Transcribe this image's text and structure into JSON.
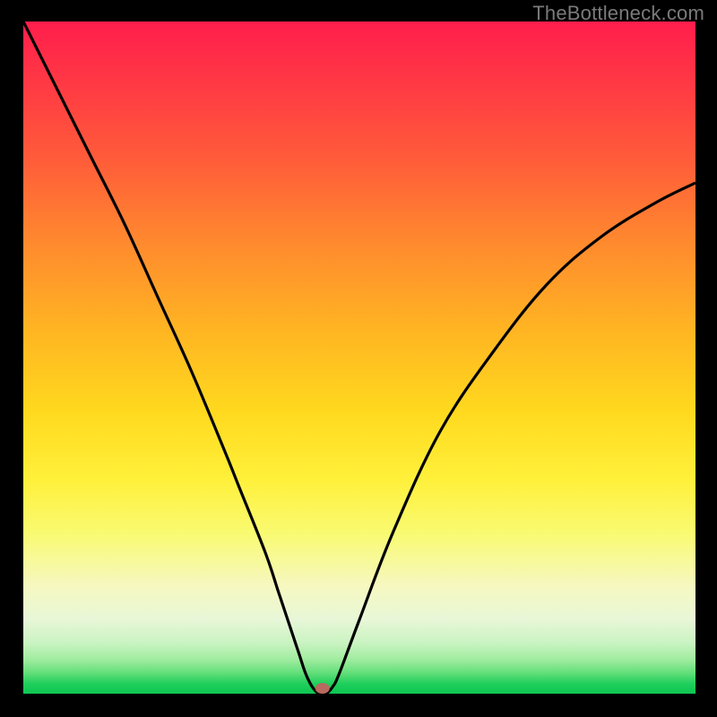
{
  "watermark": {
    "text": "TheBottleneck.com"
  },
  "chart_data": {
    "type": "line",
    "title": "",
    "xlabel": "",
    "ylabel": "",
    "xlim": [
      0,
      100
    ],
    "ylim": [
      0,
      100
    ],
    "grid": false,
    "series": [
      {
        "name": "bottleneck-curve",
        "x": [
          0,
          5,
          10,
          15,
          20,
          25,
          30,
          32,
          36,
          38,
          40,
          41,
          42,
          43,
          44,
          45,
          46,
          47,
          50,
          55,
          62,
          70,
          78,
          86,
          94,
          100
        ],
        "values": [
          100,
          90,
          80,
          70,
          59,
          48,
          36,
          31,
          21,
          15,
          9,
          6,
          3,
          1,
          0,
          0,
          1,
          3,
          11,
          24,
          39,
          51,
          61,
          68,
          73,
          76
        ]
      }
    ],
    "marker": {
      "x": 44.5,
      "y": 0.8,
      "color": "#b86a5e"
    },
    "gradient_stops": [
      {
        "pct": 0,
        "color": "#ff1e4c"
      },
      {
        "pct": 7,
        "color": "#ff3246"
      },
      {
        "pct": 20,
        "color": "#ff5a3a"
      },
      {
        "pct": 33,
        "color": "#ff8a2e"
      },
      {
        "pct": 46,
        "color": "#ffb522"
      },
      {
        "pct": 58,
        "color": "#ffd91e"
      },
      {
        "pct": 68,
        "color": "#fff03a"
      },
      {
        "pct": 76,
        "color": "#f9fa70"
      },
      {
        "pct": 84,
        "color": "#f6f8c0"
      },
      {
        "pct": 89,
        "color": "#e8f7d8"
      },
      {
        "pct": 92.5,
        "color": "#c9f3c1"
      },
      {
        "pct": 95,
        "color": "#9eec9e"
      },
      {
        "pct": 97,
        "color": "#5fde78"
      },
      {
        "pct": 98.5,
        "color": "#20cf5c"
      },
      {
        "pct": 100,
        "color": "#0ec552"
      }
    ]
  }
}
